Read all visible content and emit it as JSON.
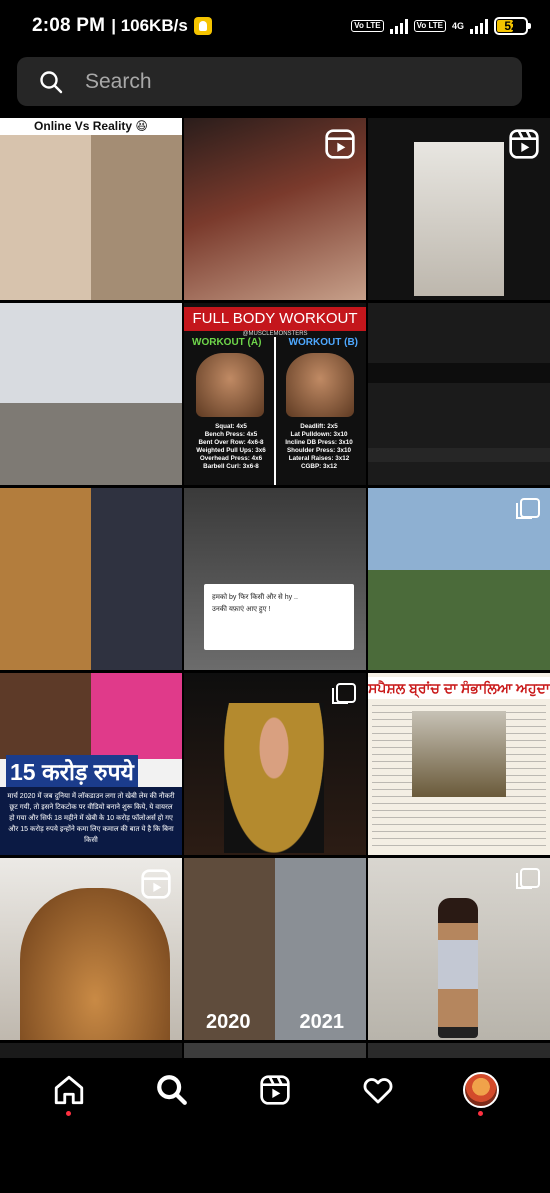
{
  "status_bar": {
    "time": "2:08 PM",
    "speed": "| 106KB/s",
    "sim1_label": "Vo LTE",
    "sim2_label": "Vo LTE",
    "network": "4G",
    "battery": "52"
  },
  "search": {
    "placeholder": "Search"
  },
  "grid": {
    "tile1_caption": "Online Vs Reality 😆",
    "tile5_title": "FULL BODY WORKOUT",
    "tile5_handle": "@MUSCLEMONSTERS",
    "tile5_workout_a": "WORKOUT (A)",
    "tile5_workout_b": "WORKOUT (B)",
    "tile5_list_a": "Squat: 4x5\nBench Press: 4x5\nBent Over Row: 4x6-8\nWeighted Pull Ups: 3x6\nOverhead Press: 4x6\nBarbell Curl: 3x6-8",
    "tile5_list_b": "Deadlift: 2x5\nLat Pulldown: 3x10\nIncline DB Press: 3x10\nShoulder Press: 3x10\nLateral Raises: 3x12\nCGBP: 3x12",
    "tile8_quote_1": "हमको by फिर किसी और से hy ..",
    "tile8_quote_2": "उनकी यफ़ाएं आए हुए !",
    "tile10_big": "15 करोड़ रुपये",
    "tile10_text": "मार्च 2020 में जब दुनिया में लॉकडाउन लगा तो खेबी लेम की नौकरी छूट गयी, तो इसने टिकटोक पर वीडियो बनाने शुरू किये, ये वायरल हो गया और सिर्फ 18 महीने में खेबी के 10 करोड़ फॉलोअर्स हो गए और 15 करोड़ रुपये इन्होंने कमा लिए कमाल की बात ये है कि बिना किसी",
    "tile12_title": "ਸਪੈਸ਼ਲ ਬ੍ਰਾਂਚ ਦਾ ਸੰਭਾਲਿਆ ਅਹੁਦਾ",
    "tile14_year_a": "2020",
    "tile14_year_b": "2021"
  },
  "icons": {
    "search": "search-icon",
    "reel": "reel-icon",
    "carousel": "carousel-icon",
    "home": "home-icon",
    "explore": "search-icon",
    "reels_tab": "reels-icon",
    "activity": "heart-icon",
    "profile": "avatar"
  },
  "colors": {
    "background": "#000000",
    "search_bg": "#262626",
    "notification_dot": "#ff3040"
  }
}
